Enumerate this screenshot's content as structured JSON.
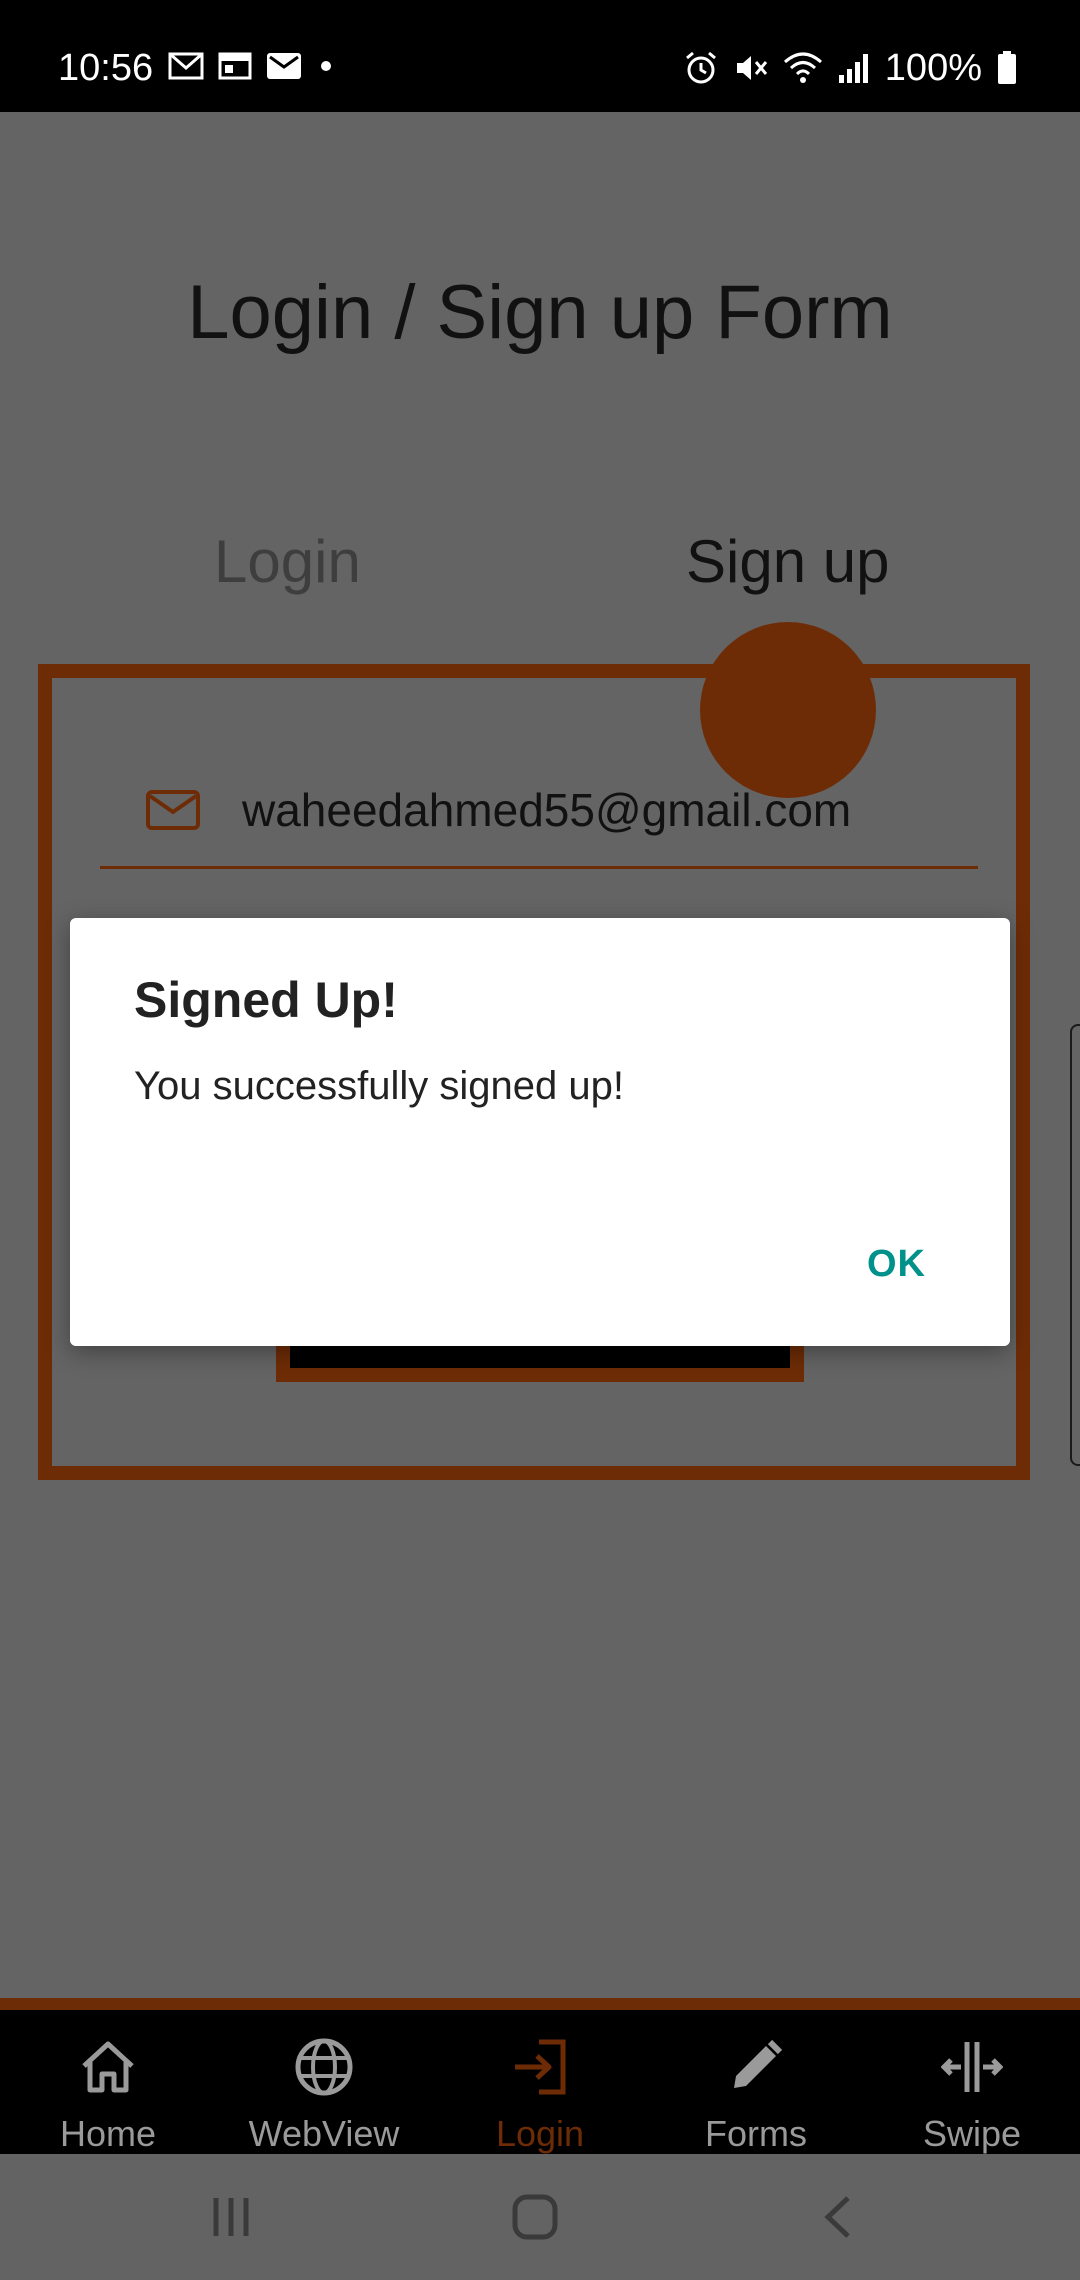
{
  "status_bar": {
    "time": "10:56",
    "battery": "100%",
    "icons": [
      "gmail-icon",
      "calendar-icon",
      "mail-icon",
      "dot-icon",
      "alarm-icon",
      "mute-icon",
      "wifi-icon",
      "signal-icon",
      "battery-icon"
    ]
  },
  "page": {
    "title": "Login / Sign up Form"
  },
  "tabs": [
    {
      "label": "Login",
      "active": false
    },
    {
      "label": "Sign up",
      "active": true
    }
  ],
  "form": {
    "email_value": "waheedahmed55@gmail.com"
  },
  "dialog": {
    "title": "Signed Up!",
    "message": "You successfully signed up!",
    "ok_label": "OK"
  },
  "bottom_nav": {
    "items": [
      {
        "label": "Home",
        "icon": "home-icon",
        "active": false
      },
      {
        "label": "WebView",
        "icon": "globe-icon",
        "active": false
      },
      {
        "label": "Login",
        "icon": "login-icon",
        "active": true
      },
      {
        "label": "Forms",
        "icon": "pencil-icon",
        "active": false
      },
      {
        "label": "Swipe",
        "icon": "swipe-icon",
        "active": false
      }
    ]
  },
  "colors": {
    "accent": "#6e2c06",
    "dialog_button": "#00928a",
    "scrim": "#646464"
  }
}
